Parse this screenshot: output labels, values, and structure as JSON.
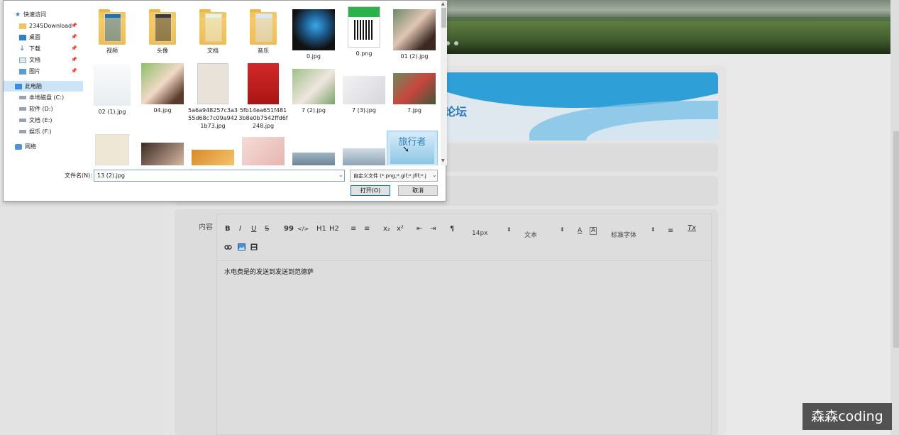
{
  "background": {
    "forum_title": "论坛",
    "content_label": "内容",
    "editor": {
      "toolbar_row1": [
        "B",
        "I",
        "U",
        "S",
        "99",
        "</>",
        "H1",
        "H2",
        "≡",
        "≡",
        "x₂",
        "x²",
        "⇤",
        "⇥",
        "¶",
        "14px",
        "文本",
        "A",
        "A",
        "标准字体",
        "≡",
        "Tx"
      ],
      "font_size_value": "14px",
      "text_type_value": "文本",
      "font_family_value": "标准字体",
      "body_text": "水电费是的发送到发送到范德萨"
    }
  },
  "dialog": {
    "nav": [
      {
        "label": "快速访问",
        "icon": "star-icon"
      },
      {
        "label": "2345Download",
        "icon": "folder-icon",
        "pinned": true
      },
      {
        "label": "桌面",
        "icon": "desktop-icon",
        "pinned": true
      },
      {
        "label": "下载",
        "icon": "download-icon",
        "pinned": true
      },
      {
        "label": "文档",
        "icon": "documents-icon",
        "pinned": true
      },
      {
        "label": "图片",
        "icon": "pictures-icon",
        "pinned": true
      },
      {
        "label": "此电脑",
        "icon": "computer-icon"
      },
      {
        "label": "本地磁盘 (C:)",
        "icon": "drive-icon"
      },
      {
        "label": "软件 (D:)",
        "icon": "drive-icon"
      },
      {
        "label": "文档 (E:)",
        "icon": "drive-icon"
      },
      {
        "label": "娱乐 (F:)",
        "icon": "drive-icon"
      },
      {
        "label": "网络",
        "icon": "network-icon"
      }
    ],
    "files_row1": [
      "视频",
      "头像",
      "文档",
      "音乐",
      "0.jpg",
      "0.png",
      "01 (2).jpg"
    ],
    "files_row2": [
      "02 (1).jpg",
      "04.jpg",
      "5a6a948257c3a355d68c7c09a9421b73.jpg",
      "5fb14ea651f4813b8e0b7542ffd6f248.jpg",
      "7 (2).jpg",
      "7 (3).jpg",
      "7.jpg"
    ],
    "selected_thumb_text": "旅行者",
    "filename_label": "文件名(N):",
    "filename_value": "13 (2).jpg",
    "filetype_value": "自定义文件 (*.png;*.gif;*.jfif;*.j",
    "open_button": "打开(O)",
    "cancel_button": "取消"
  },
  "watermark": "森森coding",
  "colors": {
    "accent": "#0078d7",
    "selection": "#cce4f7",
    "forum_blue": "#2a7bbd"
  }
}
